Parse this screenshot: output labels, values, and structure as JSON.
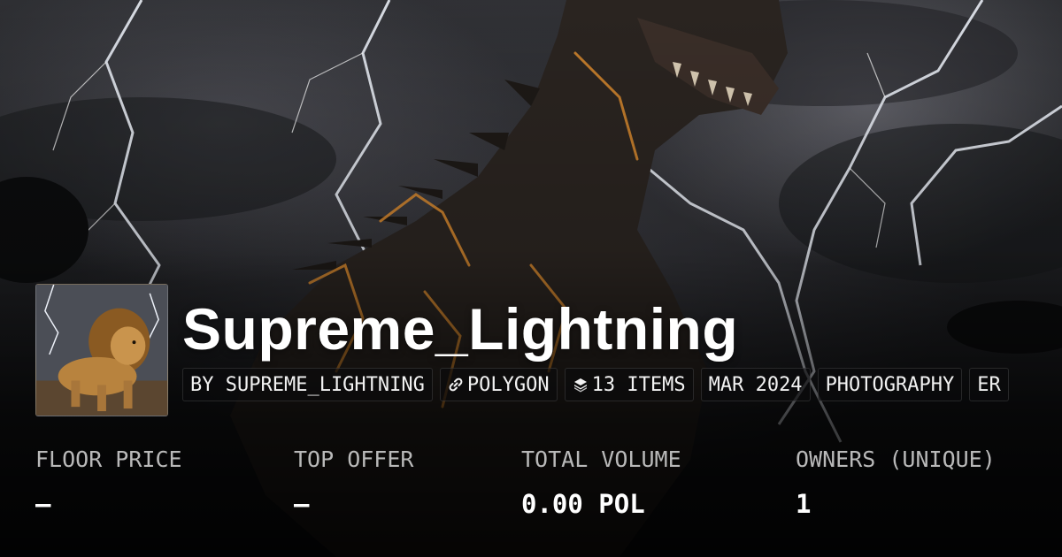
{
  "collection": {
    "name": "Supreme_Lightning",
    "avatar_icon": "lion-avatar-icon",
    "tags": [
      {
        "label": "BY SUPREME_LIGHTNING",
        "icon": ""
      },
      {
        "label": "POLYGON",
        "icon": "chain-link-icon"
      },
      {
        "label": "13 ITEMS",
        "icon": "layers-icon"
      },
      {
        "label": "MAR 2024",
        "icon": ""
      },
      {
        "label": "PHOTOGRAPHY",
        "icon": ""
      },
      {
        "label": "ER",
        "icon": ""
      }
    ]
  },
  "stats": [
    {
      "label": "FLOOR PRICE",
      "value": "–"
    },
    {
      "label": "TOP OFFER",
      "value": "–"
    },
    {
      "label": "TOTAL VOLUME",
      "value": "0.00 POL"
    },
    {
      "label": "OWNERS (UNIQUE)",
      "value": "1"
    }
  ],
  "colors": {
    "background": "#0e0f11",
    "text": "#ffffff",
    "muted_text": "#b9b9b9",
    "lightning": "#e8ecf4",
    "glow": "#d9892e"
  }
}
